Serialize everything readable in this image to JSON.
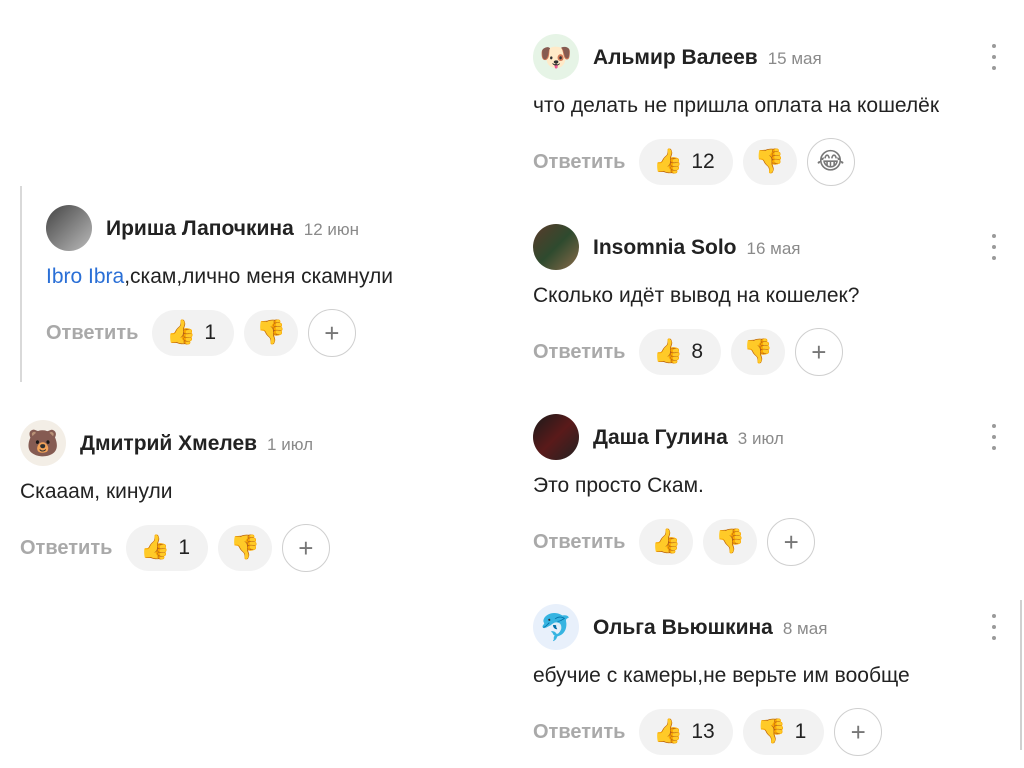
{
  "reply_label": "Ответить",
  "comments": [
    {
      "name": "Ириша Лапочкина",
      "date": "12 июн",
      "mention": "Ibro Ibra",
      "text": ",скам,лично меня скамнули",
      "likes": "1",
      "dislikes": ""
    },
    {
      "name": "Дмитрий Хмелев",
      "date": "1 июл",
      "text": "Скааам, кинули",
      "likes": "1",
      "dislikes": ""
    },
    {
      "name": "Альмир Валеев",
      "date": "15 мая",
      "text": "что делать не пришла оплата на кошелёк",
      "likes": "12",
      "dislikes": "",
      "extra_reaction": "laughing-emoji"
    },
    {
      "name": "Insomnia Solo",
      "date": "16 мая",
      "text": "Сколько идёт вывод на кошелек?",
      "likes": "8",
      "dislikes": ""
    },
    {
      "name": "Даша Гулина",
      "date": "3 июл",
      "text": "Это просто Скам.",
      "likes": "",
      "dislikes": ""
    },
    {
      "name": "Ольга Вьюшкина",
      "date": "8 мая",
      "text": "ебучие с камеры,не верьте им вообще",
      "likes": "13",
      "dislikes": "1"
    }
  ],
  "icons": {
    "like": "thumbs-up-icon",
    "dislike": "thumbs-down-icon",
    "add": "plus-icon",
    "more": "more-vertical-icon"
  },
  "colors": {
    "mention": "#2a6fd6",
    "muted": "#8a8a8a",
    "pill_bg": "#f2f2f2"
  }
}
